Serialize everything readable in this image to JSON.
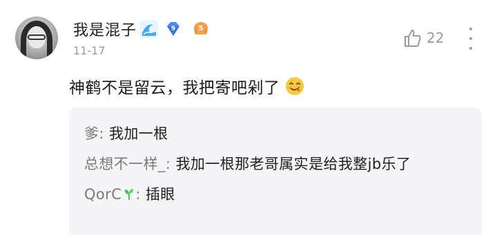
{
  "comment": {
    "username": "我是混子",
    "date": "11-17",
    "like_count": "22",
    "text": "神鹤不是留云，我把寄吧剁了",
    "badges": {
      "gem_level": "9",
      "wave": "wave-badge",
      "level": "5"
    },
    "emoji": "savoring-food-emoji"
  },
  "replies": [
    {
      "author": "爹",
      "separator": ": ",
      "text": "我加一根"
    },
    {
      "author": "总想不一样_",
      "separator": ": ",
      "text": "我加一根那老哥属实是给我整jb乐了"
    },
    {
      "author": "QorC",
      "separator": ": ",
      "text": "插眼"
    }
  ],
  "colors": {
    "gem_blue": "#4b8df8",
    "wave_blue": "#3fa9f5",
    "level_orange": "#f7a14a",
    "emoji_yellow": "#f8c93a",
    "reply_bg": "#f5f5f7",
    "muted": "#9a9a9a"
  }
}
